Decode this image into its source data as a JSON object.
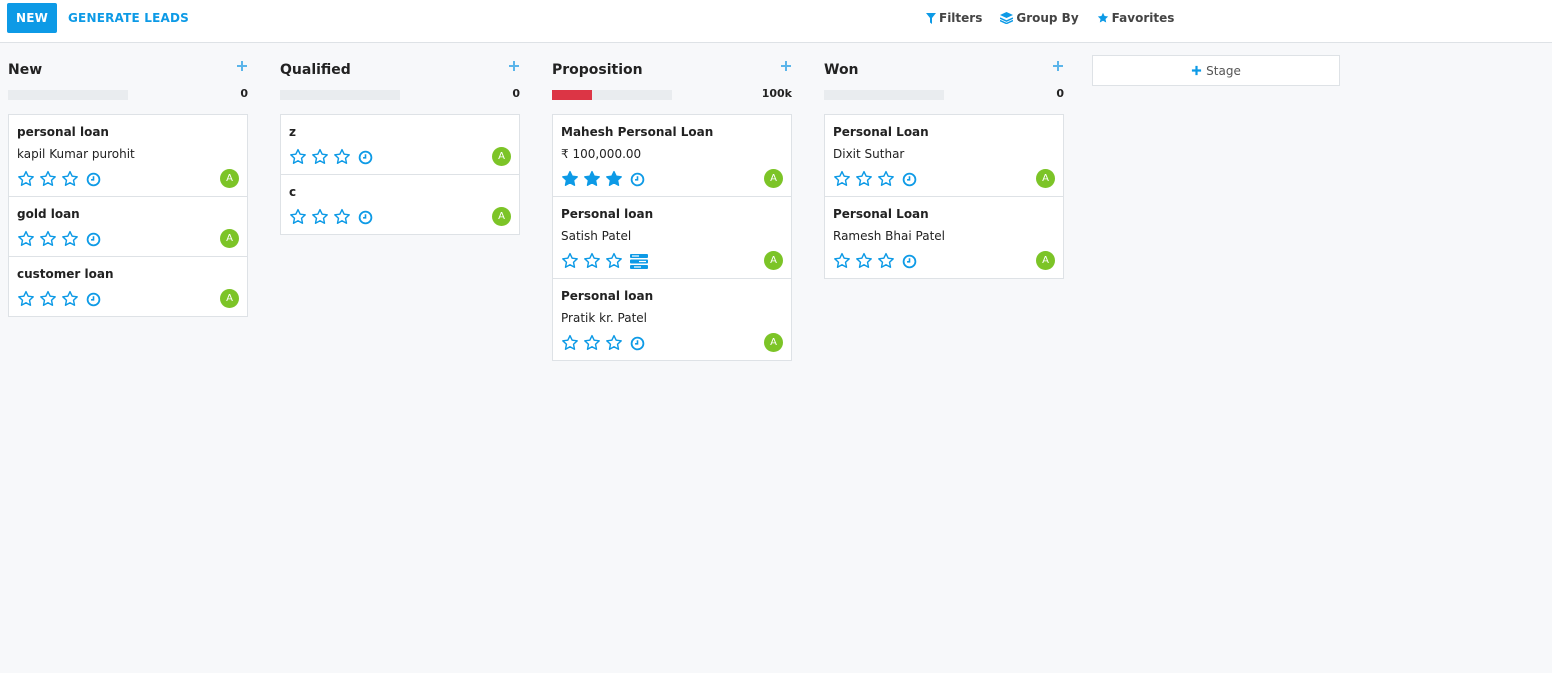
{
  "toolbar": {
    "new_label": "NEW",
    "generate_label": "GENERATE LEADS"
  },
  "search": {
    "filters": "Filters",
    "group_by": "Group By",
    "favorites": "Favorites"
  },
  "colors": {
    "accent": "#0d9ae6",
    "danger": "#dc3545",
    "avatar": "#7cc427"
  },
  "columns": [
    {
      "title": "New",
      "total": "0",
      "progress_fraction": 0,
      "cards": [
        {
          "name": "personal loan",
          "sub": "kapil Kumar purohit",
          "stars": 0,
          "activity": "clock-icon",
          "avatar": "A"
        },
        {
          "name": "gold loan",
          "sub": "",
          "stars": 0,
          "activity": "clock-icon",
          "avatar": "A"
        },
        {
          "name": "customer loan",
          "sub": "",
          "stars": 0,
          "activity": "clock-icon",
          "avatar": "A"
        }
      ]
    },
    {
      "title": "Qualified",
      "total": "0",
      "progress_fraction": 0,
      "cards": [
        {
          "name": "z",
          "sub": "",
          "stars": 0,
          "activity": "clock-icon",
          "avatar": "A"
        },
        {
          "name": "c",
          "sub": "",
          "stars": 0,
          "activity": "clock-icon",
          "avatar": "A"
        }
      ]
    },
    {
      "title": "Proposition",
      "total": "100k",
      "progress_fraction": 0.33,
      "cards": [
        {
          "name": "Mahesh Personal Loan",
          "sub": "₹ 100,000.00",
          "stars": 3,
          "activity": "clock-icon",
          "avatar": "A"
        },
        {
          "name": "Personal loan",
          "sub": "Satish Patel",
          "stars": 0,
          "activity": "tasks-icon",
          "avatar": "A"
        },
        {
          "name": "Personal loan",
          "sub": "Pratik kr. Patel",
          "stars": 0,
          "activity": "clock-icon",
          "avatar": "A"
        }
      ]
    },
    {
      "title": "Won",
      "total": "0",
      "progress_fraction": 0,
      "cards": [
        {
          "name": "Personal Loan",
          "sub": "Dixit Suthar",
          "stars": 0,
          "activity": "clock-icon",
          "avatar": "A"
        },
        {
          "name": "Personal Loan",
          "sub": "Ramesh Bhai Patel",
          "stars": 0,
          "activity": "clock-icon",
          "avatar": "A"
        }
      ]
    }
  ],
  "stage": {
    "label": "Stage"
  }
}
